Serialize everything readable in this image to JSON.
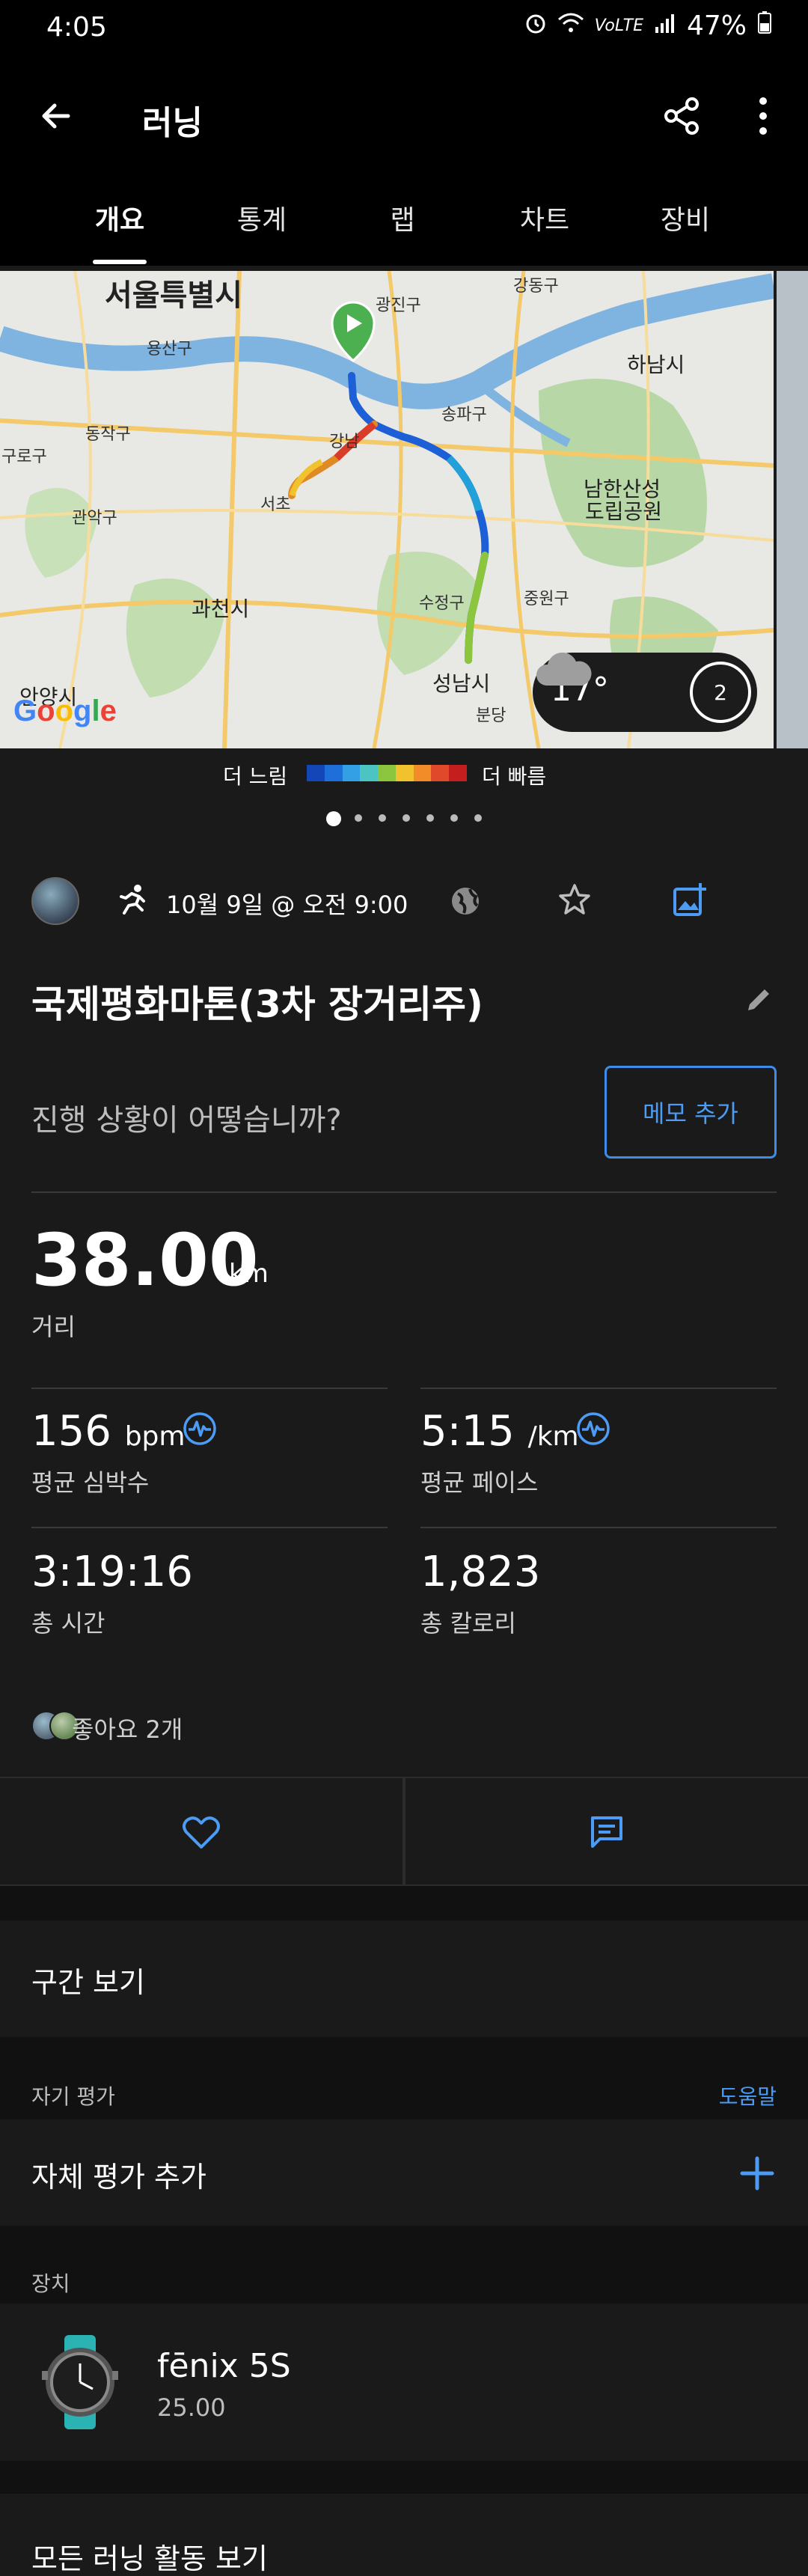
{
  "status_bar": {
    "time": "4:05",
    "network": "VoLTE",
    "battery": "47%"
  },
  "app_bar": {
    "title": "러닝"
  },
  "tabs": [
    {
      "label": "개요"
    },
    {
      "label": "통계"
    },
    {
      "label": "랩"
    },
    {
      "label": "차트"
    },
    {
      "label": "장비"
    }
  ],
  "map": {
    "labels": {
      "seoul": "서울특별시",
      "hanam": "하남시",
      "namhansanseong": "남한산성",
      "namhansanseong2": "도립공원",
      "gwacheon": "과천시",
      "anyang": "안양시",
      "seongnam": "성남시",
      "gwangjin": "광진구",
      "gangdong": "강동구",
      "songpa": "송파구",
      "gangnam": "강남",
      "seocho": "서초",
      "yongsan": "용산구",
      "dongjak": "동작구",
      "gwanak": "관악구",
      "guro": "구로구",
      "sujeong": "수정구",
      "jungwon": "중원구",
      "bundang": "분당"
    },
    "weather": {
      "temperature": "17°",
      "badge": "2"
    },
    "legend": {
      "slow": "더 느림",
      "fast": "더 빠름",
      "colors": [
        "#1546b8",
        "#1e6fd9",
        "#33a0e6",
        "#4cc4c2",
        "#8cc63f",
        "#f2c12e",
        "#f28c28",
        "#e04a2a",
        "#c41e1e"
      ]
    },
    "logo": "Google"
  },
  "meta": {
    "date": "10월 9일 @ 오전 9:00"
  },
  "activity": {
    "title": "국제평화마톤(3차 장거리주)"
  },
  "notes": {
    "prompt": "진행 상황이 어떻습니까?",
    "button": "메모 추가"
  },
  "distance": {
    "value": "38.00",
    "unit": "km",
    "label": "거리"
  },
  "stats": {
    "hr": {
      "value": "156",
      "unit": "bpm",
      "label": "평균 심박수"
    },
    "pace": {
      "value": "5:15",
      "unit": "/km",
      "label": "평균 페이스"
    },
    "time": {
      "value": "3:19:16",
      "label": "총 시간"
    },
    "calories": {
      "value": "1,823",
      "label": "총 칼로리"
    }
  },
  "likes": {
    "text": "좋아요 2개"
  },
  "sections": {
    "splits": "구간 보기",
    "self_eval_label": "자기 평가",
    "help": "도움말",
    "self_eval_add": "자체 평가 추가",
    "device_label": "장치",
    "all_runs": "모든 러닝 활동 보기"
  },
  "device": {
    "name": "fēnix 5S",
    "version": "25.00"
  },
  "colors": {
    "accent": "#4c9cf5",
    "background": "#1a1a1a",
    "start_marker": "#4caf50"
  }
}
